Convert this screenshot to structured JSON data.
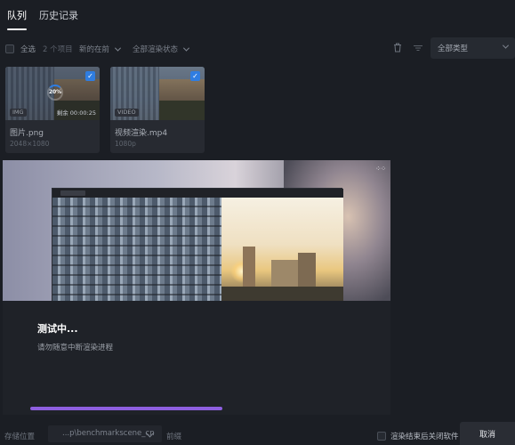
{
  "tabs": [
    {
      "label": "队列"
    },
    {
      "label": "历史记录"
    }
  ],
  "toolbar": {
    "select_all": "全选",
    "item_count": "2 个项目",
    "sort": "新的在前",
    "render_status": "全部渲染状态",
    "type_filter": "全部类型",
    "icons": [
      "trash-icon",
      "sort-icon",
      "chevron-down-icon"
    ]
  },
  "queue": [
    {
      "name": "图片.png",
      "info": "2048×1080",
      "type_badge": "IMG",
      "progress_text": "20%",
      "progress": 0.2,
      "remaining": "剩余 00:00:25",
      "selected": true
    },
    {
      "name": "视频渲染.mp4",
      "info": "1080p",
      "type_badge": "VIDEO",
      "selected": true
    }
  ],
  "preview": {
    "menu_icon": "dots-grid-icon"
  },
  "status": {
    "title": "测试中...",
    "subtitle": "请勿随意中断渲染进程",
    "progress": 0.5
  },
  "footer": {
    "storage_label": "存储位置",
    "path": "...p\\benchmarkscene_cn",
    "prefix_label": "前缀",
    "close_after_label": "渲染结束后关闭软件",
    "cancel_label": "取消"
  },
  "colors": {
    "accent": "#2f7de1",
    "progress": "#8e5fe0",
    "background": "#1b1e24"
  }
}
